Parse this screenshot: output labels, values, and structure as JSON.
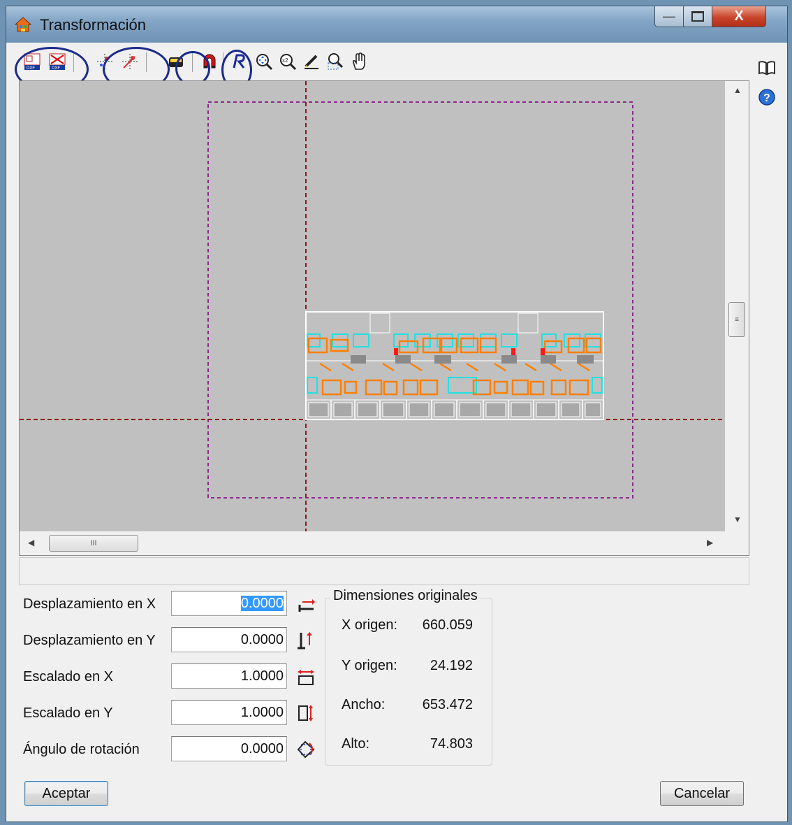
{
  "window": {
    "title": "Transformación",
    "minimize_icon": "minimize-icon",
    "maximize_icon": "maximize-icon",
    "close_icon": "close-icon"
  },
  "toolbar": {
    "buttons": [
      "dxf-import-icon",
      "dxf-remove-icon",
      "point-select-icon",
      "point-remove-icon",
      "eraser-icon",
      "magnet-icon",
      "redraw-icon",
      "zoom-extents-icon",
      "zoom-x2-icon",
      "pencil-icon",
      "zoom-window-icon",
      "pan-hand-icon"
    ],
    "side": [
      "help-book-icon",
      "help-question-icon"
    ]
  },
  "scroll": {
    "h_thumb_grip": "III"
  },
  "fields": [
    {
      "label": "Desplazamiento en X",
      "value": "0.0000",
      "icon": "move-x-icon"
    },
    {
      "label": "Desplazamiento en Y",
      "value": "0.0000",
      "icon": "move-y-icon"
    },
    {
      "label": "Escalado en X",
      "value": "1.0000",
      "icon": "scale-x-icon"
    },
    {
      "label": "Escalado en Y",
      "value": "1.0000",
      "icon": "scale-y-icon"
    },
    {
      "label": "Ángulo de rotación",
      "value": "0.0000",
      "icon": "rotate-icon"
    }
  ],
  "dimensions": {
    "title": "Dimensiones originales",
    "rows": [
      {
        "label": "X origen:",
        "value": "660.059"
      },
      {
        "label": "Y origen:",
        "value": "24.192"
      },
      {
        "label": "Ancho:",
        "value": "653.472"
      },
      {
        "label": "Alto:",
        "value": "74.803"
      }
    ]
  },
  "buttons": {
    "accept": "Aceptar",
    "cancel": "Cancelar"
  },
  "colors": {
    "canvas_bg": "#c0c0c0",
    "crosshair": "#8b1a1a",
    "frame": "#8a2a8a",
    "plan_orange": "#ff7f00",
    "plan_cyan": "#22e0e0",
    "highlight_circle": "#1a2a8c"
  }
}
